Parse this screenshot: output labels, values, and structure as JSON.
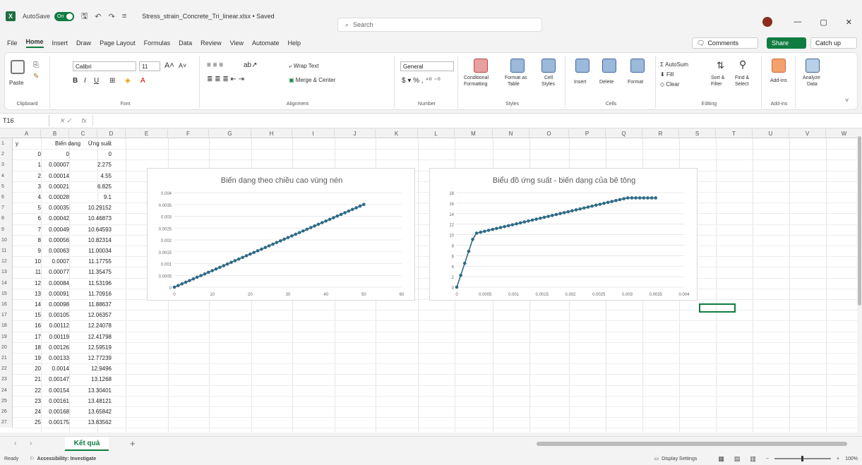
{
  "titlebar": {
    "autosave_label": "AutoSave",
    "toggle_label": "On",
    "doc_title": "Stress_strain_Concrete_Tri_linear.xlsx • Saved",
    "search_placeholder": "Search"
  },
  "menu": [
    "File",
    "Home",
    "Insert",
    "Draw",
    "Page Layout",
    "Formulas",
    "Data",
    "Review",
    "View",
    "Automate",
    "Help"
  ],
  "right_buttons": {
    "comments": "Comments",
    "share": "Share",
    "catchup": "Catch up"
  },
  "ribbon": {
    "clipboard": {
      "paste": "Paste",
      "label": "Clipboard"
    },
    "font": {
      "name": "Calibri",
      "size": "11",
      "label": "Font"
    },
    "alignment": {
      "wrap": "Wrap Text",
      "merge": "Merge & Center",
      "label": "Alignment"
    },
    "number": {
      "format": "General",
      "label": "Number"
    },
    "styles": {
      "cond": "Conditional",
      "cond2": "Formatting",
      "fmt": "Format as",
      "fmt2": "Table",
      "cell": "Cell",
      "cell2": "Styles",
      "label": "Styles"
    },
    "cells": {
      "insert": "Insert",
      "delete": "Delete",
      "format": "Format",
      "label": "Cells"
    },
    "editing": {
      "autosum": "AutoSum",
      "fill": "Fill",
      "clear": "Clear",
      "sort": "Sort &",
      "sort2": "Filter",
      "find": "Find &",
      "find2": "Select",
      "label": "Editing"
    },
    "addins": {
      "label": "Add-ins",
      "btn": "Add-ins"
    },
    "analyze": {
      "l1": "Analyze",
      "l2": "Data"
    }
  },
  "formula_bar": {
    "name_box": "T16",
    "fx": "fx"
  },
  "columns": [
    "A",
    "B",
    "C",
    "D",
    "E",
    "F",
    "G",
    "H",
    "I",
    "J",
    "K",
    "L",
    "M",
    "N",
    "O",
    "P",
    "Q",
    "R",
    "S",
    "T",
    "U",
    "V",
    "W"
  ],
  "rows": [
    "1",
    "2",
    "3",
    "4",
    "5",
    "6",
    "7",
    "8",
    "9",
    "10",
    "11",
    "12",
    "13",
    "14",
    "15",
    "16",
    "17",
    "18",
    "19",
    "20",
    "21",
    "22",
    "23",
    "24",
    "25",
    "26",
    "27"
  ],
  "table": {
    "headers": [
      "y",
      "Biến dạng",
      "Ứng suất"
    ],
    "data": [
      [
        "0",
        "0",
        "0"
      ],
      [
        "1",
        "0.00007",
        "2.275"
      ],
      [
        "2",
        "0.00014",
        "4.55"
      ],
      [
        "3",
        "0.00021",
        "6.825"
      ],
      [
        "4",
        "0.00028",
        "9.1"
      ],
      [
        "5",
        "0.00035",
        "10.29152"
      ],
      [
        "6",
        "0.00042",
        "10.46873"
      ],
      [
        "7",
        "0.00049",
        "10.64593"
      ],
      [
        "8",
        "0.00056",
        "10.82314"
      ],
      [
        "9",
        "0.00063",
        "11.00034"
      ],
      [
        "10",
        "0.0007",
        "11.17755"
      ],
      [
        "11",
        "0.00077",
        "11.35475"
      ],
      [
        "12",
        "0.00084",
        "11.53196"
      ],
      [
        "13",
        "0.00091",
        "11.70916"
      ],
      [
        "14",
        "0.00098",
        "11.88637"
      ],
      [
        "15",
        "0.00105",
        "12.06357"
      ],
      [
        "16",
        "0.00112",
        "12.24078"
      ],
      [
        "17",
        "0.00119",
        "12.41798"
      ],
      [
        "18",
        "0.00126",
        "12.59519"
      ],
      [
        "19",
        "0.00133",
        "12.77239"
      ],
      [
        "20",
        "0.0014",
        "12.9496"
      ],
      [
        "21",
        "0.00147",
        "13.1268"
      ],
      [
        "22",
        "0.00154",
        "13.30401"
      ],
      [
        "23",
        "0.00161",
        "13.48121"
      ],
      [
        "24",
        "0.00168",
        "13.65842"
      ],
      [
        "25",
        "0.00175",
        "13.83562"
      ]
    ]
  },
  "chart_data": [
    {
      "type": "scatter",
      "title": "Biến dạng theo chiều cao vùng nén",
      "xlim": [
        0,
        60
      ],
      "ylim": [
        0,
        0.004
      ],
      "xticks": [
        "0",
        "10",
        "20",
        "30",
        "40",
        "50",
        "60"
      ],
      "yticks": [
        "0",
        "0.0005",
        "0.001",
        "0.0015",
        "0.002",
        "0.0025",
        "0.003",
        "0.0035",
        "0.004"
      ],
      "series": [
        {
          "x_start": 0,
          "x_end": 50,
          "x_step": 1,
          "slope": 7e-05
        }
      ],
      "color": "#2f6b86"
    },
    {
      "type": "scatter",
      "title": "Biểu đồ ứng suất - biến dạng của bê tông",
      "xlim": [
        0,
        0.004
      ],
      "ylim": [
        0,
        18
      ],
      "xticks": [
        "0",
        "0.0005",
        "0.001",
        "0.0015",
        "0.002",
        "0.0025",
        "0.003",
        "0.0035",
        "0.004"
      ],
      "yticks": [
        "0",
        "2",
        "4",
        "6",
        "8",
        "10",
        "12",
        "14",
        "16",
        "18"
      ],
      "series": [
        {
          "points_from_strain": true,
          "step": 7e-05,
          "count": 51,
          "knee1": [
            0.00028,
            9.1
          ],
          "knee2": [
            0.00035,
            10.29152
          ],
          "knee3": [
            0.003,
            17.0
          ],
          "slope2": 2531.43,
          "plateau": 17.0
        }
      ],
      "color": "#2f6b86"
    }
  ],
  "sheet_tab": "Kết quả",
  "status": {
    "ready": "Ready",
    "accessibility": "Accessibility: Investigate",
    "display": "Display Settings",
    "zoom": "100%"
  }
}
